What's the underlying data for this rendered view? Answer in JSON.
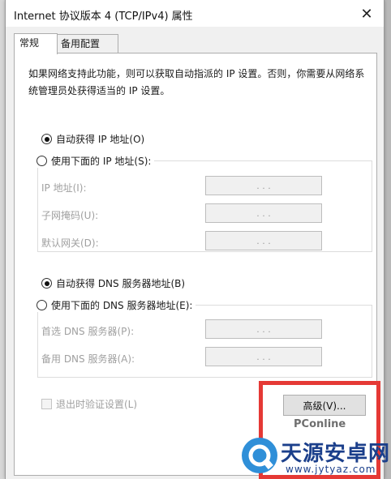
{
  "window": {
    "title": "Internet 协议版本 4 (TCP/IPv4) 属性",
    "close_glyph": "✕"
  },
  "tabs": [
    {
      "label": "常规",
      "active": true
    },
    {
      "label": "备用配置",
      "active": false
    }
  ],
  "general": {
    "description": "如果网络支持此功能，则可以获取自动指派的 IP 设置。否则，你需要从网络系统管理员处获得适当的 IP 设置。",
    "ip_auto_label": "自动获得 IP 地址(O)",
    "ip_manual_label": "使用下面的 IP 地址(S):",
    "ip_fields": [
      {
        "label": "IP 地址(I):",
        "value": ". . ."
      },
      {
        "label": "子网掩码(U):",
        "value": ". . ."
      },
      {
        "label": "默认网关(D):",
        "value": ". . ."
      }
    ],
    "dns_auto_label": "自动获得 DNS 服务器地址(B)",
    "dns_manual_label": "使用下面的 DNS 服务器地址(E):",
    "dns_fields": [
      {
        "label": "首选 DNS 服务器(P):",
        "value": ". . ."
      },
      {
        "label": "备用 DNS 服务器(A):",
        "value": ". . ."
      }
    ],
    "validate_label": "退出时验证设置(L)",
    "advanced_button": "高级(V)...",
    "ip_auto_selected": true,
    "dns_auto_selected": true
  },
  "watermark": {
    "pconline": "PConline",
    "brand": "天源安卓网",
    "url": "www.jytyaz.com"
  },
  "colors": {
    "highlight": "#e53935",
    "brand": "#1b3f8b"
  }
}
